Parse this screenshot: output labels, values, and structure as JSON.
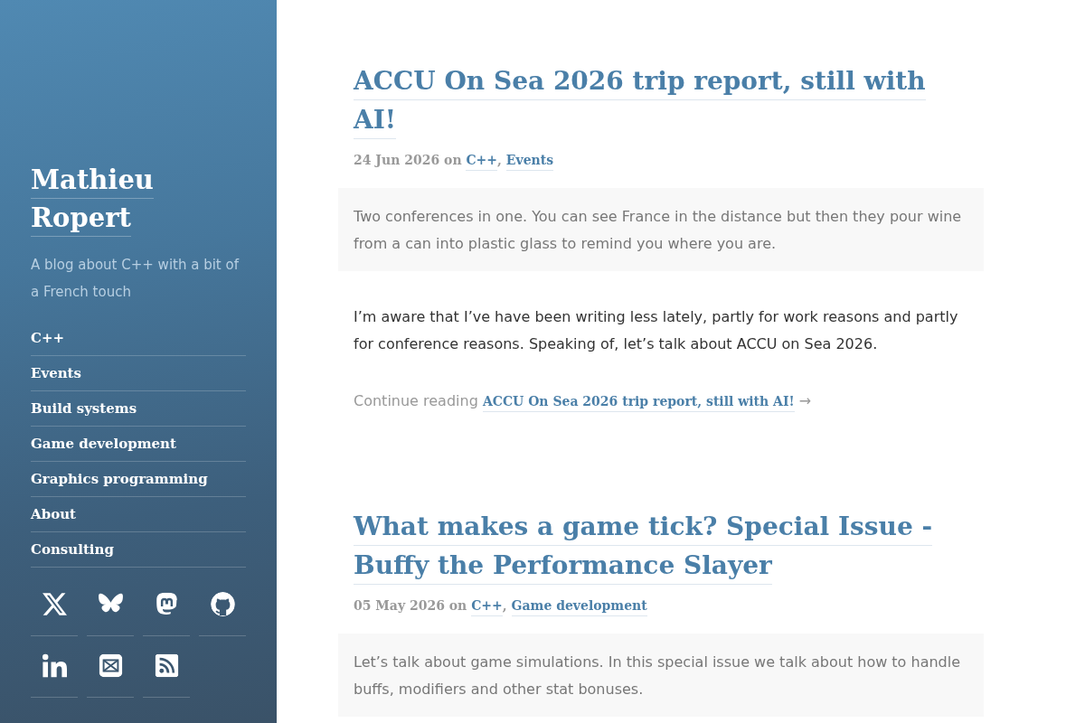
{
  "site": {
    "title": "Mathieu Ropert",
    "tagline": "A blog about C++ with a bit of a French touch"
  },
  "nav": [
    "C++",
    "Events",
    "Build systems",
    "Game development",
    "Graphics programming",
    "About",
    "Consulting"
  ],
  "social_links": [
    {
      "kind": "x"
    },
    {
      "kind": "butterfly"
    },
    {
      "kind": "mastodon"
    },
    {
      "kind": "github"
    },
    {
      "kind": "linkedin"
    },
    {
      "kind": "mail"
    },
    {
      "kind": "rss"
    }
  ],
  "posts": [
    {
      "title": "ACCU On Sea 2026 trip report, still with AI!",
      "date": "24 Jun 2026",
      "category_intro": "on",
      "categories": [
        "C++",
        "Events"
      ],
      "category_separator": ",",
      "summary": "Two conferences in one. You can see France in the distance but then they pour wine from a can into plastic glass to remind you where you are.",
      "body": "I’m aware that I’ve have been writing less lately, partly for work reasons and partly for conference reasons. Speaking of, let’s talk about ACCU on Sea 2026.",
      "continue": {
        "prefix": "Continue reading",
        "link": "ACCU On Sea 2026 trip report, still with AI!",
        "arrow": "→"
      }
    },
    {
      "title": "What makes a game tick? Special Issue - Buffy the Performance Slayer",
      "date": "05 May 2026",
      "category_intro": "on",
      "categories": [
        "C++",
        "Game development"
      ],
      "category_separator": ",",
      "summary": "Let’s talk about game simulations. In this special issue we talk about how to handle buffs, modifiers and other stat bonuses."
    }
  ]
}
